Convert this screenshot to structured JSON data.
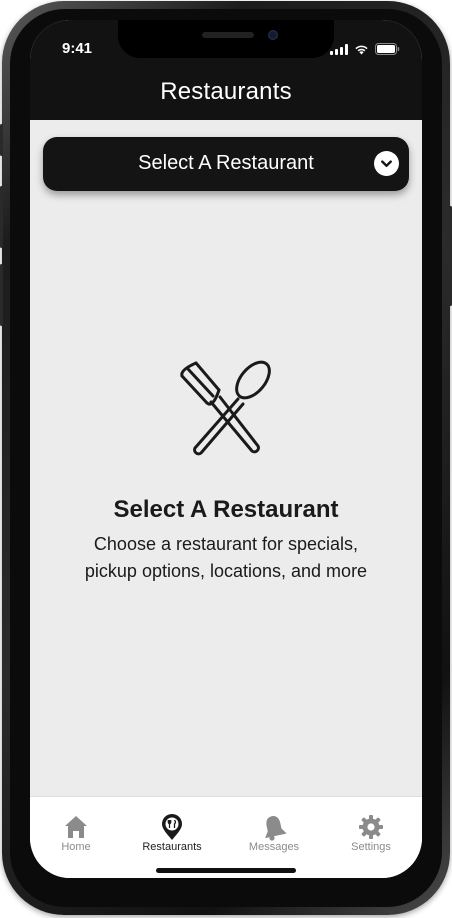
{
  "status_bar": {
    "time": "9:41"
  },
  "header": {
    "title": "Restaurants"
  },
  "selector": {
    "label": "Select A Restaurant"
  },
  "empty_state": {
    "icon": "fork-spoon-icon",
    "title": "Select A Restaurant",
    "description": "Choose a restaurant for specials, pickup options, locations, and more"
  },
  "tabbar": {
    "active": "Restaurants",
    "items": [
      {
        "label": "Home",
        "icon": "home-icon"
      },
      {
        "label": "Restaurants",
        "icon": "restaurant-pin-icon"
      },
      {
        "label": "Messages",
        "icon": "bell-icon"
      },
      {
        "label": "Settings",
        "icon": "gear-icon"
      }
    ]
  },
  "colors": {
    "header_bg": "#121212",
    "screen_bg": "#ececec",
    "tab_inactive": "#8b8b8b",
    "tab_active": "#222222"
  }
}
